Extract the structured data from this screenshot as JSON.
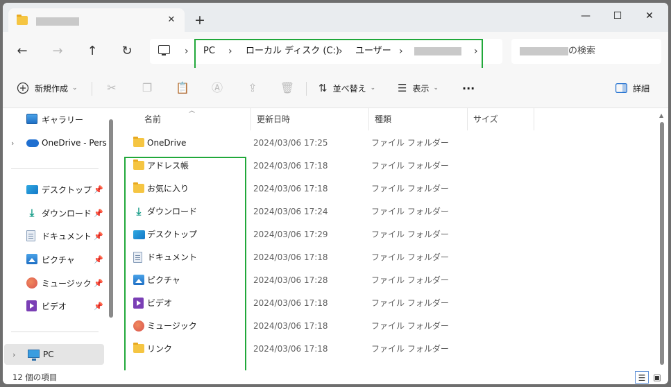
{
  "titlebar": {
    "close_tab_glyph": "✕",
    "new_tab_glyph": "+",
    "minimize_glyph": "—",
    "maximize_glyph": "☐",
    "close_glyph": "✕"
  },
  "nav": {
    "back_glyph": "←",
    "forward_glyph": "→",
    "up_glyph": "↑",
    "refresh_glyph": "↻"
  },
  "address": {
    "separator": "›",
    "crumbs": [
      "PC",
      "ローカル ディスク (C:)",
      "ユーザー"
    ]
  },
  "search": {
    "suffix_text": "の検索"
  },
  "command_bar": {
    "new_label": "新規作成",
    "sort_label": "並べ替え",
    "view_label": "表示",
    "more_glyph": "···",
    "details_label": "詳細",
    "chevron": "⌄"
  },
  "sidebar": {
    "items": [
      {
        "label": "ギャラリー",
        "icon": "gallery-icon"
      },
      {
        "label": "OneDrive - Personal",
        "icon": "onedrive-icon"
      },
      {
        "label": "デスクトップ",
        "icon": "desktop-icon"
      },
      {
        "label": "ダウンロード",
        "icon": "download-icon"
      },
      {
        "label": "ドキュメント",
        "icon": "document-icon"
      },
      {
        "label": "ピクチャ",
        "icon": "pictures-icon"
      },
      {
        "label": "ミュージック",
        "icon": "music-icon"
      },
      {
        "label": "ビデオ",
        "icon": "video-icon"
      },
      {
        "label": "PC",
        "icon": "pc-icon"
      }
    ],
    "pin_glyph": "📌",
    "expander_glyph": "›"
  },
  "columns": {
    "name": "名前",
    "modified": "更新日時",
    "type": "種類",
    "size": "サイズ"
  },
  "files": [
    {
      "name": "OneDrive",
      "date": "2024/03/06 17:25",
      "type": "ファイル フォルダー",
      "icon": "folder-icon"
    },
    {
      "name": "アドレス帳",
      "date": "2024/03/06 17:18",
      "type": "ファイル フォルダー",
      "icon": "folder-icon"
    },
    {
      "name": "お気に入り",
      "date": "2024/03/06 17:18",
      "type": "ファイル フォルダー",
      "icon": "folder-icon"
    },
    {
      "name": "ダウンロード",
      "date": "2024/03/06 17:24",
      "type": "ファイル フォルダー",
      "icon": "download-icon"
    },
    {
      "name": "デスクトップ",
      "date": "2024/03/06 17:29",
      "type": "ファイル フォルダー",
      "icon": "desktop-icon"
    },
    {
      "name": "ドキュメント",
      "date": "2024/03/06 17:18",
      "type": "ファイル フォルダー",
      "icon": "document-icon"
    },
    {
      "name": "ピクチャ",
      "date": "2024/03/06 17:28",
      "type": "ファイル フォルダー",
      "icon": "pictures-icon"
    },
    {
      "name": "ビデオ",
      "date": "2024/03/06 17:18",
      "type": "ファイル フォルダー",
      "icon": "video-icon"
    },
    {
      "name": "ミュージック",
      "date": "2024/03/06 17:18",
      "type": "ファイル フォルダー",
      "icon": "music-icon"
    },
    {
      "name": "リンク",
      "date": "2024/03/06 17:18",
      "type": "ファイル フォルダー",
      "icon": "folder-icon"
    }
  ],
  "status": {
    "item_count": "12 個の項目"
  },
  "colors": {
    "highlight": "#21a83a",
    "selection": "#e5e5e5"
  }
}
